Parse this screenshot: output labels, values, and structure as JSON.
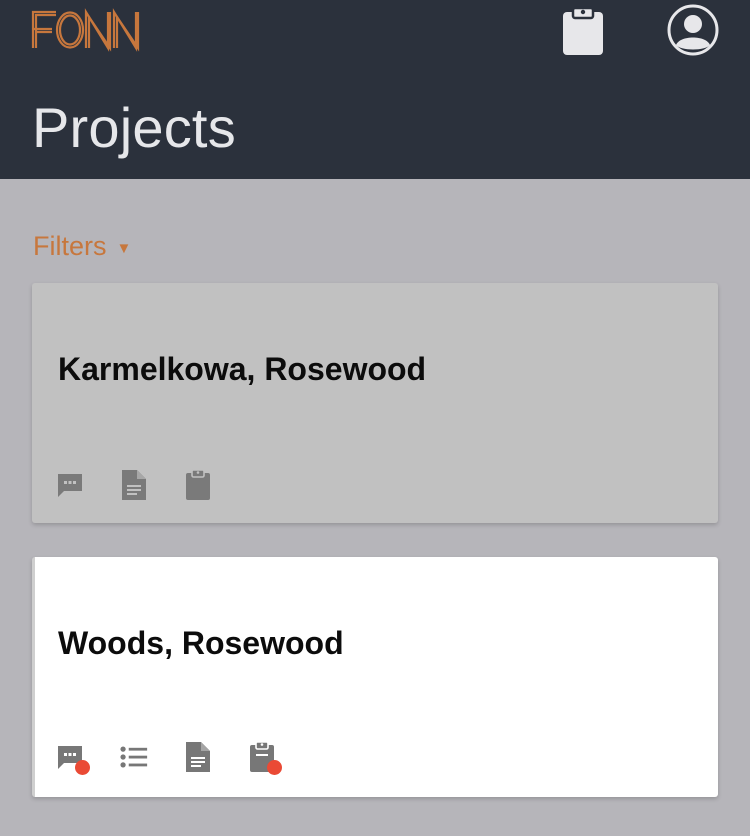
{
  "app": {
    "logo_text": "FONN",
    "page_title": "Projects",
    "brand_color": "#c7773d",
    "header_color": "#2b313c",
    "badge_color": "#ea4a35"
  },
  "header": {
    "icons": [
      "clipboard-icon",
      "account-circle-icon"
    ]
  },
  "filters": {
    "label": "Filters",
    "caret": "▼"
  },
  "projects": [
    {
      "title": "Karmelkowa, Rosewood",
      "state": "disabled",
      "actions": [
        {
          "icon": "chat-icon",
          "badge": false
        },
        {
          "icon": "document-icon",
          "badge": false
        },
        {
          "icon": "clipboard-icon",
          "badge": false
        }
      ]
    },
    {
      "title": "Woods, Rosewood",
      "state": "active",
      "actions": [
        {
          "icon": "chat-icon",
          "badge": true
        },
        {
          "icon": "list-icon",
          "badge": false
        },
        {
          "icon": "document-icon",
          "badge": false
        },
        {
          "icon": "clipboard-icon",
          "badge": true
        }
      ]
    }
  ]
}
